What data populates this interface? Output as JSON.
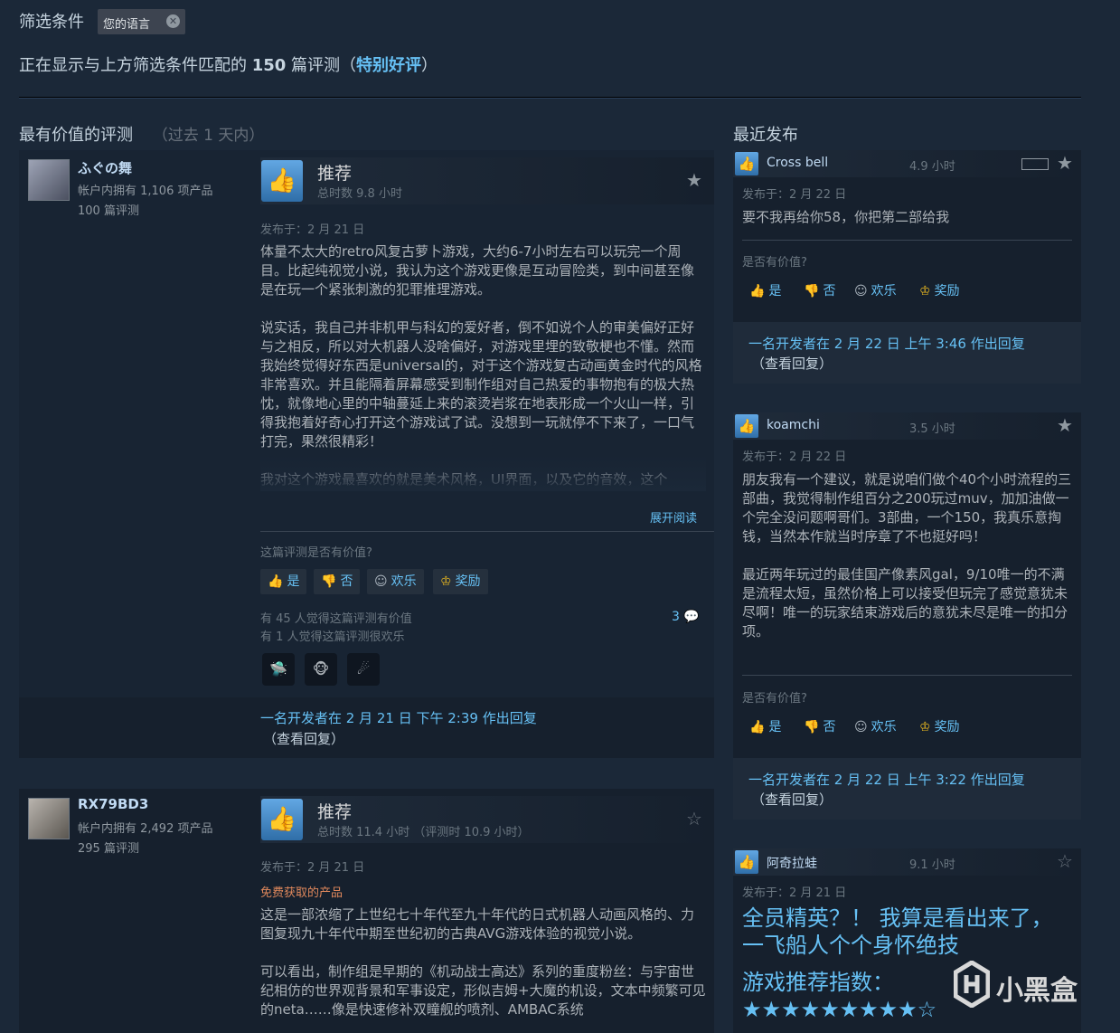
{
  "filter": {
    "label": "筛选条件",
    "chip": "您的语言",
    "chip_close": "✕"
  },
  "summary": {
    "prefix": "正在显示与上方筛选条件匹配的",
    "count": "150",
    "middle": "篇评测（",
    "rating": "特别好评",
    "suffix": "）"
  },
  "left_section": {
    "title": "最有价值的评测",
    "subtitle": "（过去 1 天内）"
  },
  "right_section": {
    "title": "最近发布"
  },
  "reviews": [
    {
      "user": "ふぐの舞",
      "products": "帐户内拥有 1,106 项产品",
      "reviews": "100 篇评测",
      "verdict": "推荐",
      "hours": "总时数 9.8 小时",
      "posted": "发布于：2 月 21 日",
      "text": "体量不太大的retro风复古萝卜游戏，大约6-7小时左右可以玩完一个周目。比起纯视觉小说，我认为这个游戏更像是互动冒险类，到中间甚至像是在玩一个紧张刺激的犯罪推理游戏。\n\n说实话，我自己并非机甲与科幻的爱好者，倒不如说个人的审美偏好正好与之相反，所以对大机器人没啥偏好，对游戏里埋的致敬梗也不懂。然而我始终觉得好东西是universal的，对于这个游戏复古动画黄金时代的风格非常喜欢。并且能隔着屏幕感受到制作组对自己热爱的事物抱有的极大热忱，就像地心里的中轴蔓延上来的滚烫岩浆在地表形成一个火山一样，引得我抱着好奇心打开这个游戏试了试。没想到一玩就停不下来了，一口气打完，果然很精彩！\n\n我对这个游戏最喜欢的就是美术风格，UI界面，以及它的音效，这个",
      "read_more": "展开阅读",
      "helpful_q": "这篇评测是否有价值?",
      "yes": "是",
      "no": "否",
      "funny": "欢乐",
      "award": "奖励",
      "helpful_count": "有 45 人觉得这篇评测有价值",
      "funny_count": "有 1 人觉得这篇评测很欢乐",
      "comments": "3",
      "reply": "一名开发者在 2 月 21 日 下午 2:39 作出回复",
      "reply_view": "（查看回复）"
    },
    {
      "user": "RX79BD3",
      "products": "帐户内拥有 2,492 项产品",
      "reviews": "295 篇评测",
      "verdict": "推荐",
      "hours": "总时数 11.4 小时 （评测时 10.9 小时）",
      "posted": "发布于：2 月 21 日",
      "free": "免费获取的产品",
      "text": "这是一部浓缩了上世纪七十年代至九十年代的日式机器人动画风格的、力图复现九十年代中期至世纪初的古典AVG游戏体验的视觉小说。\n\n可以看出，制作组是早期的《机动战士高达》系列的重度粉丝：与宇宙世纪相仿的世界观背景和军事设定，形似吉姆+大魔的机设，文本中频繁可见的neta……像是快速修补双瞳舰的喷剂、AMBAC系统"
    }
  ],
  "recent": [
    {
      "name": "Cross bell",
      "hours": "4.9 小时",
      "posted": "发布于：2 月 22 日",
      "text": "要不我再给你58，你把第二部给我",
      "helpful_q": "是否有价值?",
      "yes": "是",
      "no": "否",
      "funny": "欢乐",
      "award": "奖励",
      "reply": "一名开发者在 2 月 22 日 上午 3:46 作出回复",
      "reply_view": "（查看回复）"
    },
    {
      "name": "koamchi",
      "hours": "3.5 小时",
      "posted": "发布于：2 月 22 日",
      "text": "朋友我有一个建议，就是说咱们做个40个小时流程的三部曲，我觉得制作组百分之200玩过muv，加加油做一个完全没问题啊哥们。3部曲，一个150，我真乐意掏钱，当然本作就当时序章了不也挺好吗！\n\n最近两年玩过的最佳国产像素风gal，9/10唯一的不满是流程太短，虽然价格上可以接受但玩完了感觉意犹未尽啊！唯一的玩家结束游戏后的意犹未尽是唯一的扣分项。",
      "helpful_q": "是否有价值?",
      "yes": "是",
      "no": "否",
      "funny": "欢乐",
      "award": "奖励",
      "reply": "一名开发者在 2 月 22 日 上午 3:22 作出回复",
      "reply_view": "（查看回复）"
    },
    {
      "name": "阿奇拉蛙",
      "hours": "9.1 小时",
      "posted": "发布于：2 月 21 日",
      "big1": "全员精英？！ 我算是看出来了，\n一飞船人个个身怀绝技",
      "big2": "游戏推荐指数：\n★★★★★★★★★☆"
    }
  ],
  "watermark": "小黑盒",
  "colors": {
    "background": "#1b2838",
    "accent": "#66c0f4",
    "card": "#16202d"
  },
  "icons": {
    "thumb": "thumbs-up-icon",
    "star": "star-icon",
    "comment": "comment-icon",
    "award": "award-icon",
    "smile": "smile-icon",
    "thumb_down": "thumbs-down-icon"
  }
}
